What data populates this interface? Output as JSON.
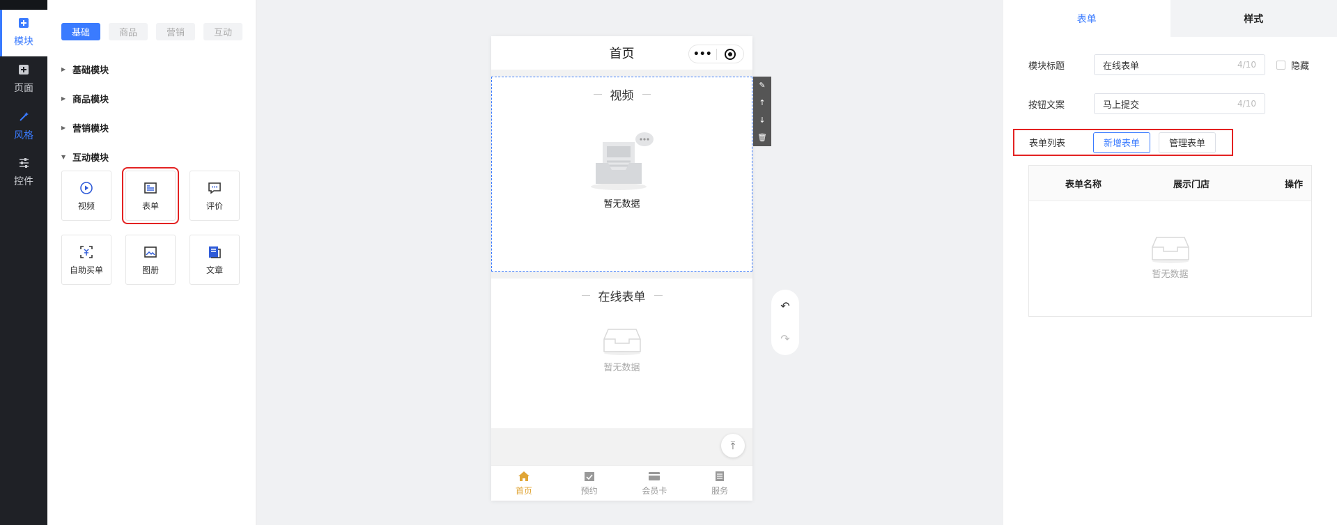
{
  "nav": {
    "items": [
      {
        "label": "模块",
        "icon": "plus-square-icon",
        "active": true
      },
      {
        "label": "页面",
        "icon": "plus-square-icon",
        "active": false
      },
      {
        "label": "风格",
        "icon": "magic-wand-icon",
        "active": false
      },
      {
        "label": "控件",
        "icon": "sliders-icon",
        "active": false
      }
    ]
  },
  "modules": {
    "tabs": [
      "基础",
      "商品",
      "营销",
      "互动"
    ],
    "groups": [
      "基础模块",
      "商品模块",
      "营销模块",
      "互动模块"
    ],
    "items": [
      {
        "label": "视频",
        "icon": "play-circle-icon"
      },
      {
        "label": "表单",
        "icon": "form-icon"
      },
      {
        "label": "评价",
        "icon": "comment-icon"
      },
      {
        "label": "自助买单",
        "icon": "scan-pay-icon"
      },
      {
        "label": "图册",
        "icon": "album-icon"
      },
      {
        "label": "文章",
        "icon": "article-icon"
      }
    ]
  },
  "phone": {
    "title": "首页",
    "capsule_dots": "•••",
    "video_block": {
      "title": "视频",
      "empty": "暂无数据"
    },
    "form_block": {
      "title": "在线表单",
      "empty": "暂无数据"
    },
    "tabbar": [
      {
        "label": "首页",
        "icon": "home-icon",
        "active": true
      },
      {
        "label": "预约",
        "icon": "calendar-check-icon",
        "active": false
      },
      {
        "label": "会员卡",
        "icon": "card-icon",
        "active": false
      },
      {
        "label": "服务",
        "icon": "list-icon",
        "active": false
      }
    ]
  },
  "toolbar": {
    "edit": "✎",
    "up": "↑",
    "down": "↓",
    "delete": "🗑"
  },
  "history": {
    "undo": "↶",
    "redo": "↷"
  },
  "back_to_top": "⤒",
  "right": {
    "tabs": [
      "表单",
      "样式"
    ],
    "module_title_label": "模块标题",
    "module_title_value": "在线表单",
    "module_title_count": "4/10",
    "hide_label": "隐藏",
    "button_text_label": "按钮文案",
    "button_text_value": "马上提交",
    "button_text_count": "4/10",
    "form_list_label": "表单列表",
    "add_form_button": "新增表单",
    "manage_form_button": "管理表单",
    "table_headers": [
      "表单名称",
      "展示门店",
      "操作"
    ],
    "table_empty": "暂无数据"
  }
}
